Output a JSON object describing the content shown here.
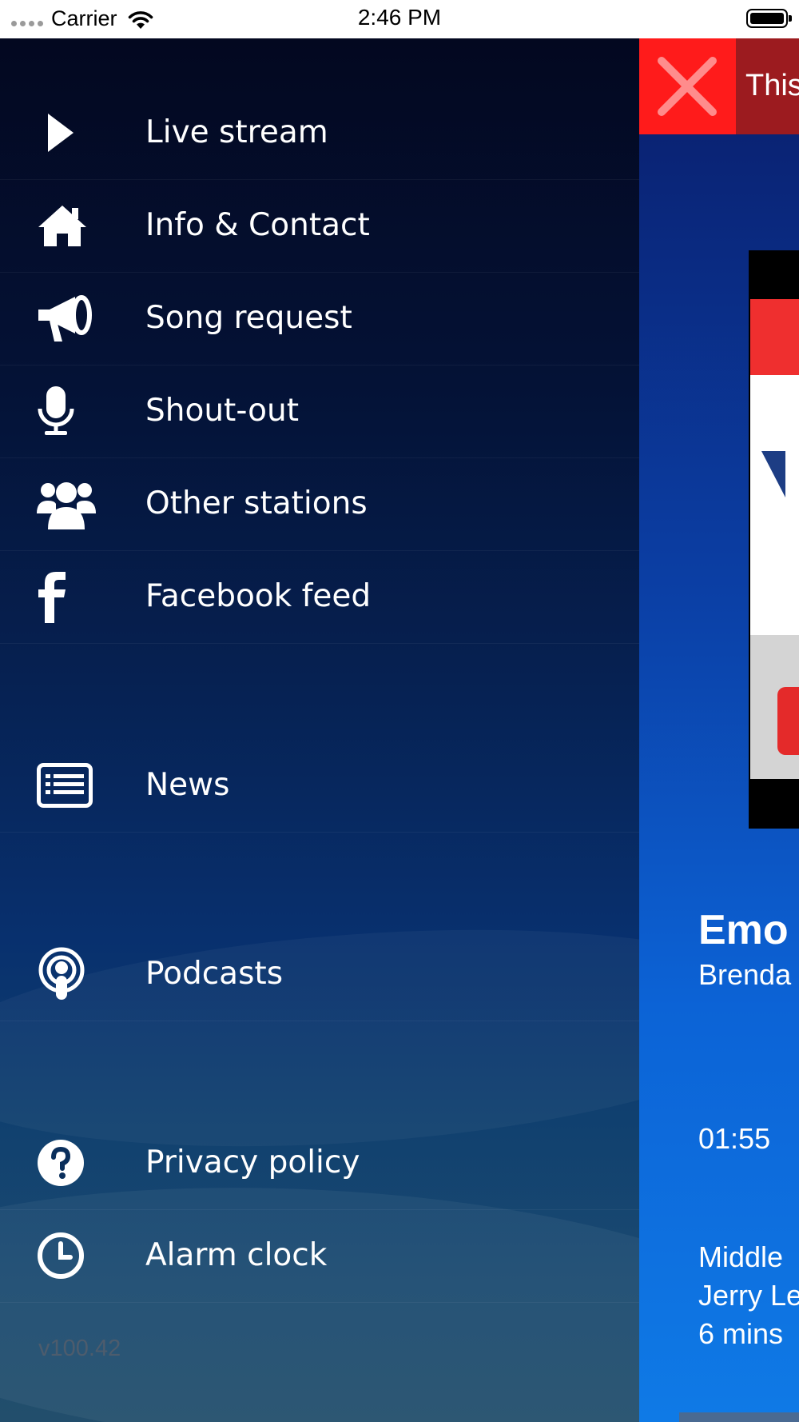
{
  "status_bar": {
    "carrier": "Carrier",
    "time": "2:46 PM"
  },
  "menu": {
    "items": [
      {
        "label": "Live stream",
        "icon": "play-icon"
      },
      {
        "label": "Info & Contact",
        "icon": "home-icon"
      },
      {
        "label": "Song request",
        "icon": "megaphone-icon"
      },
      {
        "label": "Shout-out",
        "icon": "microphone-icon"
      },
      {
        "label": "Other stations",
        "icon": "users-icon"
      },
      {
        "label": "Facebook feed",
        "icon": "facebook-icon"
      },
      {
        "label": "News",
        "icon": "news-icon"
      },
      {
        "label": "Podcasts",
        "icon": "podcast-icon"
      },
      {
        "label": "Privacy policy",
        "icon": "question-icon"
      },
      {
        "label": "Alarm clock",
        "icon": "clock-icon"
      }
    ],
    "version": "v100.42"
  },
  "player": {
    "notice_text": "This",
    "song_title": "Emo",
    "song_artist": "Brenda",
    "elapsed": "01:55",
    "next_line1": "Middle",
    "next_line2": "Jerry Le",
    "next_line3": "6 mins"
  },
  "colors": {
    "close_red": "#ff1b1b",
    "notice_bar": "#9c1b1f",
    "drawer_top": "#030820",
    "drawer_bottom": "#224e6c",
    "version_text": "#4d5c6d"
  }
}
